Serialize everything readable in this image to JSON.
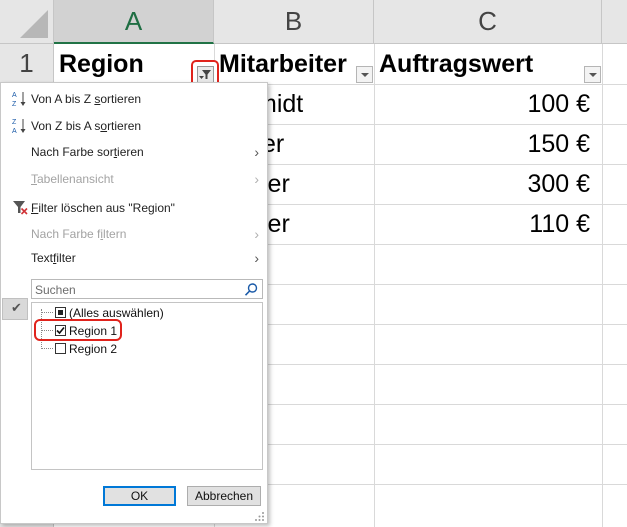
{
  "columns": [
    {
      "letter": "A"
    },
    {
      "letter": "B"
    },
    {
      "letter": "C"
    }
  ],
  "row_numbers": [
    "1"
  ],
  "headers": {
    "a": "Region",
    "b": "Mitarbeiter",
    "c": "Auftragswert"
  },
  "rows": [
    {
      "b": "midt",
      "c": "100 €"
    },
    {
      "b": "er",
      "c": "150 €"
    },
    {
      "b": "ler",
      "c": "300 €"
    },
    {
      "b": "ler",
      "c": "110 €"
    }
  ],
  "filter_menu": {
    "sort_az": {
      "pre": "Von A bis Z ",
      "u": "s",
      "post": "ortieren"
    },
    "sort_za": {
      "pre": "Von Z bis A s",
      "u": "o",
      "post": "rtieren"
    },
    "sort_color": {
      "pre": "Nach Farbe sor",
      "u": "t",
      "post": "ieren"
    },
    "table_view": {
      "pre": "",
      "u": "T",
      "post": "abellenansicht"
    },
    "clear_filter": {
      "pre": "",
      "u": "F",
      "post": "ilter löschen aus \"Region\""
    },
    "filter_color": {
      "pre": "Nach Farbe f",
      "u": "i",
      "post": "ltern"
    },
    "text_filter": {
      "pre": "Text",
      "u": "f",
      "post": "ilter"
    },
    "search_placeholder": "Suchen",
    "items": [
      {
        "label": "(Alles auswählen)",
        "state": "indeterminate"
      },
      {
        "label": "Region 1",
        "state": "checked"
      },
      {
        "label": "Region 2",
        "state": "unchecked"
      }
    ],
    "ok_label": "OK",
    "cancel_label": "Abbrechen"
  },
  "colors": {
    "accent": "#217346",
    "highlight": "#e0231c",
    "disabled": "#a3a3a3"
  }
}
